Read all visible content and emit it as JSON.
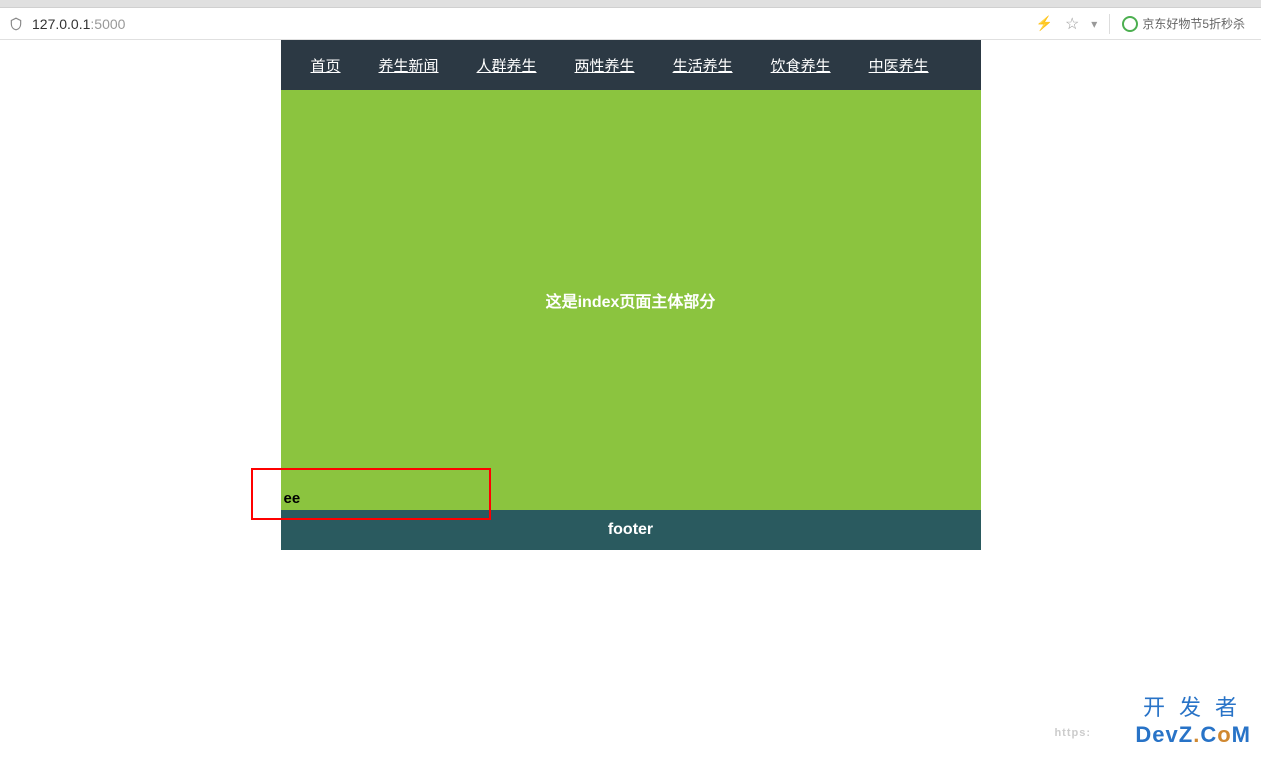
{
  "browser": {
    "url_host": "127.0.0.1",
    "url_port": ":5000",
    "promo_text": "京东好物节5折秒杀"
  },
  "nav": {
    "items": [
      {
        "label": "首页"
      },
      {
        "label": "养生新闻"
      },
      {
        "label": "人群养生"
      },
      {
        "label": "两性养生"
      },
      {
        "label": "生活养生"
      },
      {
        "label": "饮食养生"
      },
      {
        "label": "中医养生"
      }
    ]
  },
  "main": {
    "body_text": "这是index页面主体部分",
    "ee_text": "ee"
  },
  "footer": {
    "text": "footer"
  },
  "watermark": {
    "line1": "开发者",
    "https": "https:",
    "d": "D",
    "e": "e",
    "v": "v",
    "z": "Z",
    "dot": ".",
    "c": "C",
    "o": "o",
    "m": "M"
  }
}
